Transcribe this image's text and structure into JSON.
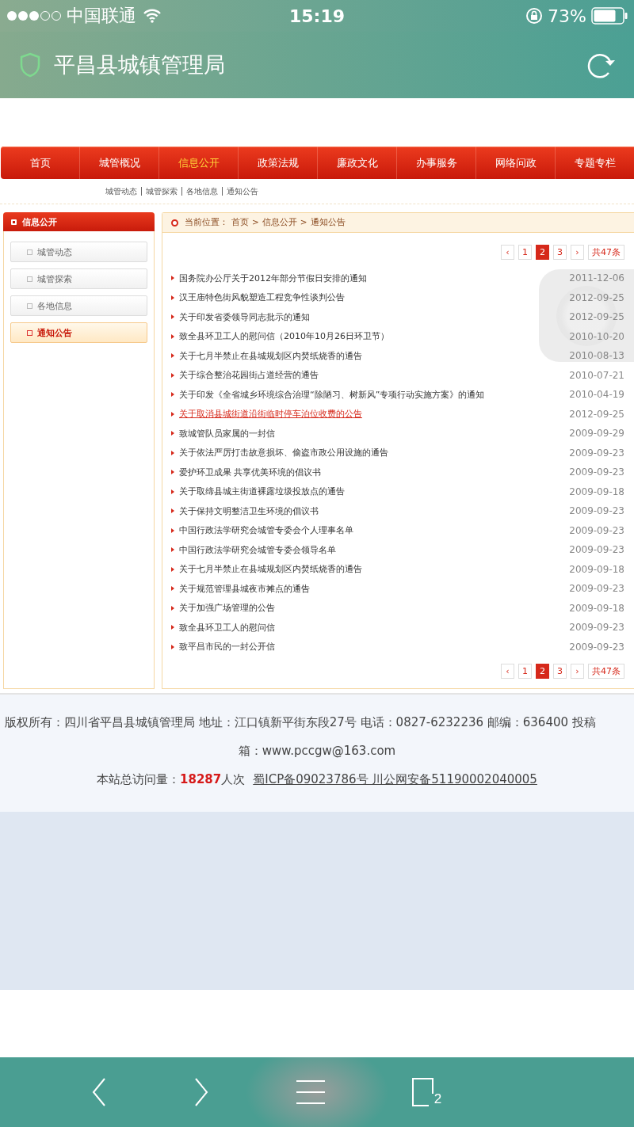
{
  "status_bar": {
    "carrier": "中国联通",
    "time": "15:19",
    "battery": "73%"
  },
  "address_bar": {
    "title": "平昌县城镇管理局"
  },
  "nav": [
    {
      "label": "首页",
      "selected": false
    },
    {
      "label": "城管概况",
      "selected": false
    },
    {
      "label": "信息公开",
      "selected": true
    },
    {
      "label": "政策法规",
      "selected": false
    },
    {
      "label": "廉政文化",
      "selected": false
    },
    {
      "label": "办事服务",
      "selected": false
    },
    {
      "label": "网络问政",
      "selected": false
    },
    {
      "label": "专题专栏",
      "selected": false
    }
  ],
  "sub_nav": [
    "城管动态",
    "城管探索",
    "各地信息",
    "通知公告"
  ],
  "sidebar": {
    "title": "信息公开",
    "items": [
      {
        "label": "城管动态",
        "selected": false
      },
      {
        "label": "城管探索",
        "selected": false
      },
      {
        "label": "各地信息",
        "selected": false
      },
      {
        "label": "通知公告",
        "selected": true
      }
    ]
  },
  "breadcrumb": {
    "label": "当前位置：",
    "items": [
      "首页",
      ">",
      "信息公开",
      ">",
      "通知公告"
    ]
  },
  "pagination_top": {
    "prev": "‹",
    "pages": [
      {
        "label": "1",
        "selected": false
      },
      {
        "label": "2",
        "selected": true
      },
      {
        "label": "3",
        "selected": false
      }
    ],
    "next": "›",
    "total": "共47条"
  },
  "articles": [
    {
      "title": "国务院办公厅关于2012年部分节假日安排的通知",
      "date": "2011-12-06",
      "hovered": false
    },
    {
      "title": "汉王庙特色街风貌塑造工程竞争性谈判公告",
      "date": "2012-09-25",
      "hovered": false
    },
    {
      "title": "关于印发省委领导同志批示的通知",
      "date": "2012-09-25",
      "hovered": false
    },
    {
      "title": "致全县环卫工人的慰问信（2010年10月26日环卫节）",
      "date": "2010-10-20",
      "hovered": false
    },
    {
      "title": "关于七月半禁止在县城规划区内焚纸烧香的通告",
      "date": "2010-08-13",
      "hovered": false
    },
    {
      "title": "关于综合整治花园街占道经营的通告",
      "date": "2010-07-21",
      "hovered": false
    },
    {
      "title": "关于印发《全省城乡环境综合治理“除陋习、树新风”专项行动实施方案》的通知",
      "date": "2010-04-19",
      "hovered": false
    },
    {
      "title": "关于取消县城街道沿街临时停车泊位收费的公告",
      "date": "2012-09-25",
      "hovered": true
    },
    {
      "title": "致城管队员家属的一封信",
      "date": "2009-09-29",
      "hovered": false
    },
    {
      "title": "关于依法严厉打击故意损坏、偷盗市政公用设施的通告",
      "date": "2009-09-23",
      "hovered": false
    },
    {
      "title": "爱护环卫成果 共享优美环境的倡议书",
      "date": "2009-09-23",
      "hovered": false
    },
    {
      "title": "关于取缔县城主街道裸露垃圾投放点的通告",
      "date": "2009-09-18",
      "hovered": false
    },
    {
      "title": "关于保持文明整洁卫生环境的倡议书",
      "date": "2009-09-23",
      "hovered": false
    },
    {
      "title": "中国行政法学研究会城管专委会个人理事名单",
      "date": "2009-09-23",
      "hovered": false
    },
    {
      "title": "中国行政法学研究会城管专委会领导名单",
      "date": "2009-09-23",
      "hovered": false
    },
    {
      "title": "关于七月半禁止在县城规划区内焚纸烧香的通告",
      "date": "2009-09-18",
      "hovered": false
    },
    {
      "title": "关于规范管理县城夜市摊点的通告",
      "date": "2009-09-23",
      "hovered": false
    },
    {
      "title": "关于加强广场管理的公告",
      "date": "2009-09-18",
      "hovered": false
    },
    {
      "title": "致全县环卫工人的慰问信",
      "date": "2009-09-23",
      "hovered": false
    },
    {
      "title": "致平昌市民的一封公开信",
      "date": "2009-09-23",
      "hovered": false
    }
  ],
  "pagination_bottom": {
    "prev": "‹",
    "pages": [
      {
        "label": "1",
        "selected": false
      },
      {
        "label": "2",
        "selected": true
      },
      {
        "label": "3",
        "selected": false
      }
    ],
    "next": "›",
    "total": "共47条"
  },
  "footer": {
    "line_1": "版权所有：四川省平昌县城镇管理局 地址：江口镇新平街东段27号 电话：0827-6232236 邮编：636400 投稿",
    "line_2": "箱：www.pccgw@163.com",
    "visits_label": "本站总访问量：",
    "visits_count": "18287",
    "visits_unit": "人次",
    "icp": "蜀ICP备09023786号 川公网安备51190002040005"
  },
  "toolbar": {
    "tab_count": "2"
  }
}
